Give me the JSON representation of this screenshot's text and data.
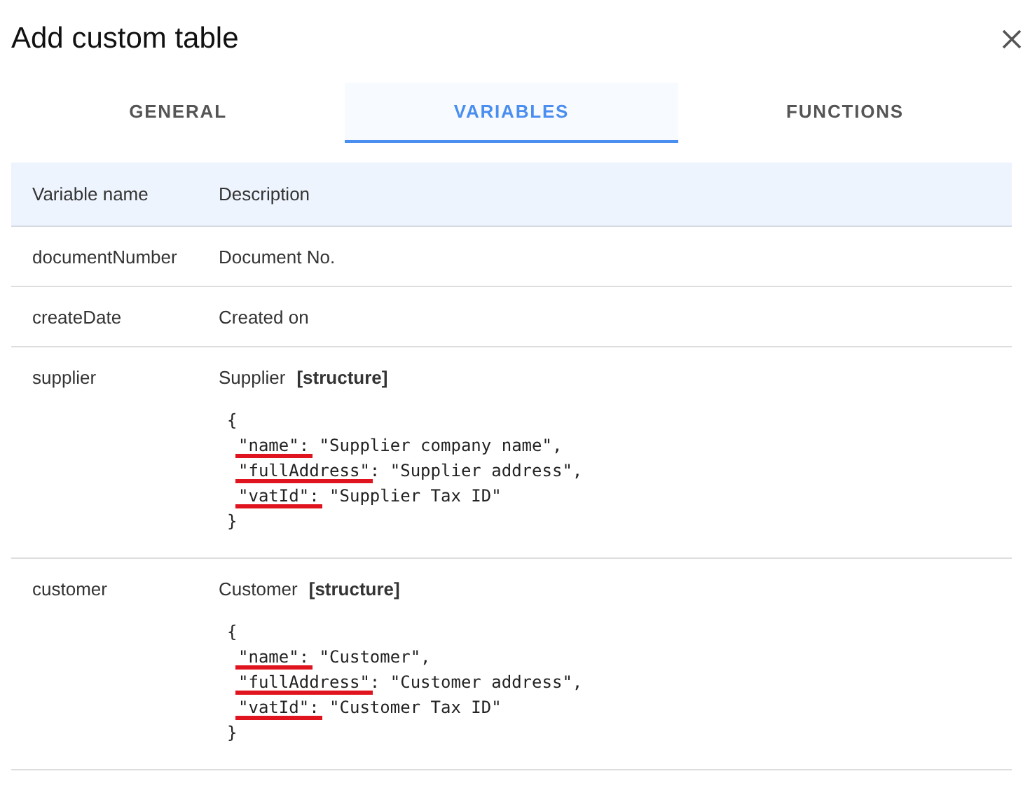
{
  "dialog": {
    "title": "Add custom table"
  },
  "tabs": [
    {
      "label": "GENERAL",
      "selected": false
    },
    {
      "label": "VARIABLES",
      "selected": true
    },
    {
      "label": "FUNCTIONS",
      "selected": false
    }
  ],
  "table": {
    "columns": [
      "Variable name",
      "Description"
    ],
    "rows": [
      {
        "name": "documentNumber",
        "description": "Document No."
      },
      {
        "name": "createDate",
        "description": "Created on"
      },
      {
        "name": "supplier",
        "description": "Supplier",
        "tag": "[structure]",
        "code": {
          "open": "{",
          "close": "}",
          "lines": [
            {
              "key": "\"name\":",
              "value": " \"Supplier company name\",",
              "underlined": true
            },
            {
              "key": "\"fullAddress\"",
              "value": ": \"Supplier address\",",
              "underlined": true
            },
            {
              "key": "\"vatId\":",
              "value": " \"Supplier Tax ID\"",
              "underlined": true
            }
          ]
        }
      },
      {
        "name": "customer",
        "description": "Customer",
        "tag": "[structure]",
        "code": {
          "open": "{",
          "close": "}",
          "lines": [
            {
              "key": "\"name\":",
              "value": " \"Customer\",",
              "underlined": true
            },
            {
              "key": "\"fullAddress\"",
              "value": ": \"Customer address\",",
              "underlined": true
            },
            {
              "key": "\"vatId\":",
              "value": " \"Customer Tax ID\"",
              "underlined": true
            }
          ]
        }
      }
    ]
  }
}
